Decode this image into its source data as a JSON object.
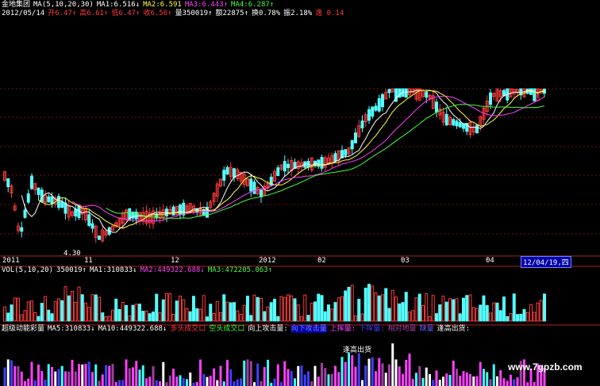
{
  "stock": {
    "name": "金地集团",
    "ma_label": "MA(5,10,20,30)",
    "ma1": "MA1:6.516↓",
    "ma2": "MA2:6.591",
    "ma3": "MA3:6.443↑",
    "ma4": "MA4:6.287↑",
    "date": "2012/05/14",
    "open": "开6.47↑",
    "high": "高6.61↑",
    "low": "低6.47↑",
    "close": "收6.56↑",
    "volume": "量350019↑",
    "amount": "额22875↑",
    "turnover": "换0.78%",
    "amplitude": "振2.18%",
    "trailing": "逸 0.14"
  },
  "price_axis": {
    "low_marker": "4.30",
    "months": [
      "2011",
      "11",
      "12",
      "2012",
      "02",
      "03",
      "04"
    ],
    "cursor_date": "12/04/19,四"
  },
  "volume_panel": {
    "label": "VOL(5,10,20)",
    "value": "350019↑",
    "ma1": "MA1:310833↓",
    "ma2": "MA2:449322.688↓",
    "ma3": "MA3:472205.063↑"
  },
  "indicator_panel": {
    "label": "超级动能彩量",
    "ma5": "MA5:310833↓",
    "ma10": "MA10:449322.688↓",
    "items": [
      "多头成交口",
      "空头成交口",
      "向上攻击量:",
      "向下攻击量",
      "上挥量:",
      "下挥量:",
      "相对地量",
      "缺量",
      "逢高出货:"
    ],
    "annotation": "逢高出货"
  },
  "watermark": "www.7gpzb.com",
  "colors": {
    "up": "#ff3b3b",
    "down": "#54ffff",
    "ma5": "#ffffff",
    "ma10": "#ffff40",
    "ma20": "#ff40ff",
    "ma30": "#40ff40",
    "grid": "#7a1414"
  }
}
